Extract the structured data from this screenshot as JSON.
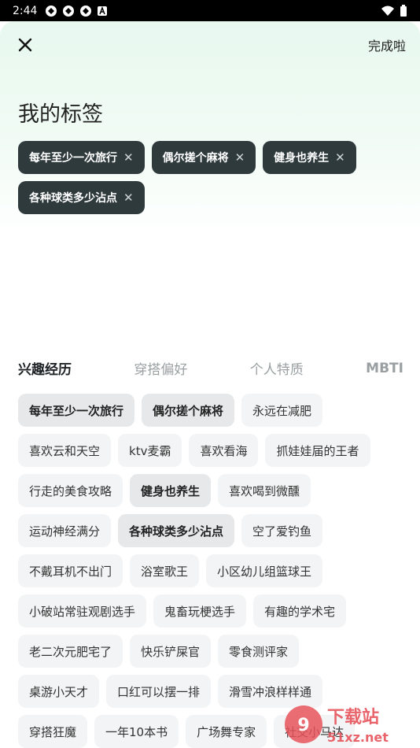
{
  "status": {
    "time": "2:44"
  },
  "header": {
    "done_label": "完成啦",
    "title": "我的标签"
  },
  "my_tags": [
    {
      "label": "每年至少一次旅行"
    },
    {
      "label": "偶尔搓个麻将"
    },
    {
      "label": "健身也养生"
    },
    {
      "label": "各种球类多少沾点"
    }
  ],
  "tabs": [
    {
      "label": "兴趣经历",
      "active": true
    },
    {
      "label": "穿搭偏好"
    },
    {
      "label": "个人特质"
    },
    {
      "label": "MBTI"
    }
  ],
  "tag_rows": [
    [
      {
        "label": "每年至少一次旅行",
        "selected": true
      },
      {
        "label": "偶尔搓个麻将",
        "selected": true
      },
      {
        "label": "永远在减肥"
      }
    ],
    [
      {
        "label": "喜欢云和天空"
      },
      {
        "label": "ktv麦霸"
      },
      {
        "label": "喜欢看海"
      },
      {
        "label": "抓娃娃届的王者"
      }
    ],
    [
      {
        "label": "行走的美食攻略"
      },
      {
        "label": "健身也养生",
        "selected": true
      },
      {
        "label": "喜欢喝到微醺"
      }
    ],
    [
      {
        "label": "运动神经满分"
      },
      {
        "label": "各种球类多少沾点",
        "selected": true
      },
      {
        "label": "空了爱钓鱼"
      }
    ],
    [
      {
        "label": "不戴耳机不出门"
      },
      {
        "label": "浴室歌王"
      },
      {
        "label": "小区幼儿组篮球王"
      }
    ],
    [
      {
        "label": "小破站常驻观剧选手"
      },
      {
        "label": "鬼畜玩梗选手"
      },
      {
        "label": "有趣的学术宅"
      }
    ],
    [
      {
        "label": "老二次元肥宅了"
      },
      {
        "label": "快乐铲屎官"
      },
      {
        "label": "零食测评家"
      }
    ],
    [
      {
        "label": "桌游小天才"
      },
      {
        "label": "口红可以摆一排"
      },
      {
        "label": "滑雪冲浪样样通"
      }
    ],
    [
      {
        "label": "穿搭狂魔"
      },
      {
        "label": "一年10本书"
      },
      {
        "label": "广场舞专家"
      },
      {
        "label": "社交小马达"
      }
    ]
  ],
  "watermark": {
    "text_main": "下载站",
    "text_url": "51xz.net"
  },
  "colors": {
    "accent_underline": "#c9f07a",
    "my_tag_bg": "#2f3a3d",
    "tag_bg": "#f3f4f5"
  }
}
